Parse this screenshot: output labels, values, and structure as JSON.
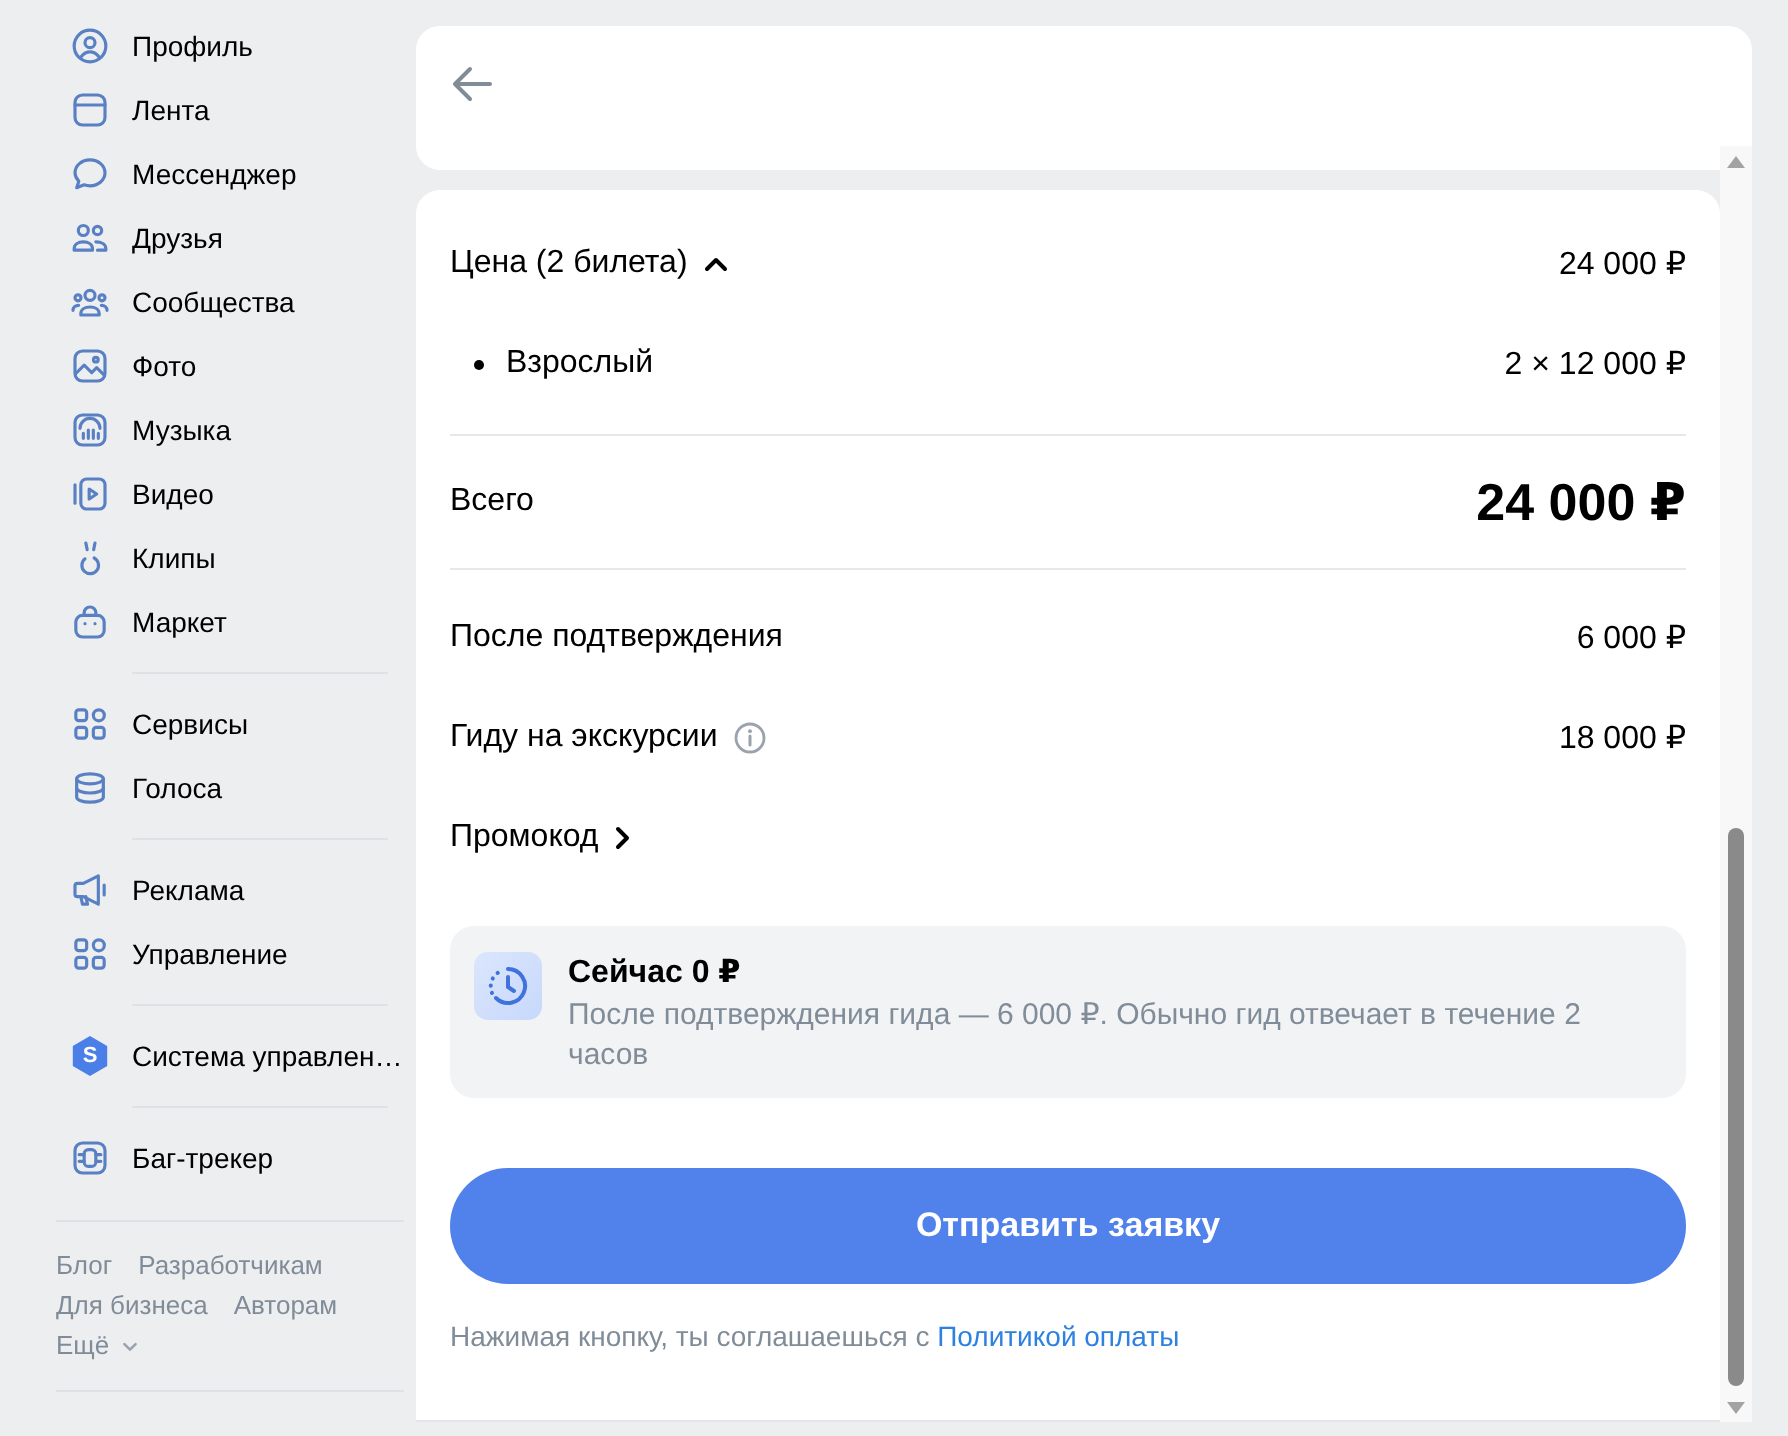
{
  "sidebar": {
    "sections": [
      {
        "items": [
          {
            "label": "Профиль",
            "selected": false
          },
          {
            "label": "Лента",
            "selected": false
          },
          {
            "label": "Мессенджер",
            "selected": false
          },
          {
            "label": "Друзья",
            "selected": false
          },
          {
            "label": "Сообщества",
            "selected": false
          },
          {
            "label": "Фото",
            "selected": false
          },
          {
            "label": "Музыка",
            "selected": false
          },
          {
            "label": "Видео",
            "selected": false
          },
          {
            "label": "Клипы",
            "selected": false
          },
          {
            "label": "Маркет",
            "selected": false
          }
        ]
      },
      {
        "items": [
          {
            "label": "Сервисы",
            "selected": false
          },
          {
            "label": "Голоса",
            "selected": false
          }
        ]
      },
      {
        "items": [
          {
            "label": "Реклама",
            "selected": false
          },
          {
            "label": "Управление",
            "selected": false
          }
        ]
      },
      {
        "items": [
          {
            "label": "Система управлен…",
            "selected": false,
            "logo_letter": "S"
          }
        ]
      },
      {
        "items": [
          {
            "label": "Баг-трекер",
            "selected": false
          }
        ]
      }
    ],
    "footer_links": [
      {
        "label": "Блог"
      },
      {
        "label": "Разработчикам"
      },
      {
        "label": "Для бизнеса"
      },
      {
        "label": "Авторам"
      }
    ],
    "more": {
      "label": "Ещё"
    }
  },
  "price": {
    "label": "Цена (2 билета)",
    "expanded": true,
    "value": "24 000 ₽",
    "items": [
      {
        "label": "Взрослый",
        "value": "2 × 12 000 ₽"
      }
    ]
  },
  "total": {
    "label": "Всего",
    "value": "24 000 ₽"
  },
  "payments": [
    {
      "label": "После подтверждения",
      "value": "6 000 ₽",
      "info": false
    },
    {
      "label": "Гиду на экскурсии",
      "value": "18 000 ₽",
      "info": true
    }
  ],
  "promo": {
    "label": "Промокод"
  },
  "notice": {
    "title": "Сейчас 0 ₽",
    "text": "После подтверждения гида — 6 000 ₽. Обычно гид отвечает в течение 2 часов"
  },
  "submit": {
    "label": "Отправить заявку"
  },
  "consent": {
    "text": "Нажимая кнопку, ты соглашаешься с",
    "link": "Политикой оплаты"
  }
}
